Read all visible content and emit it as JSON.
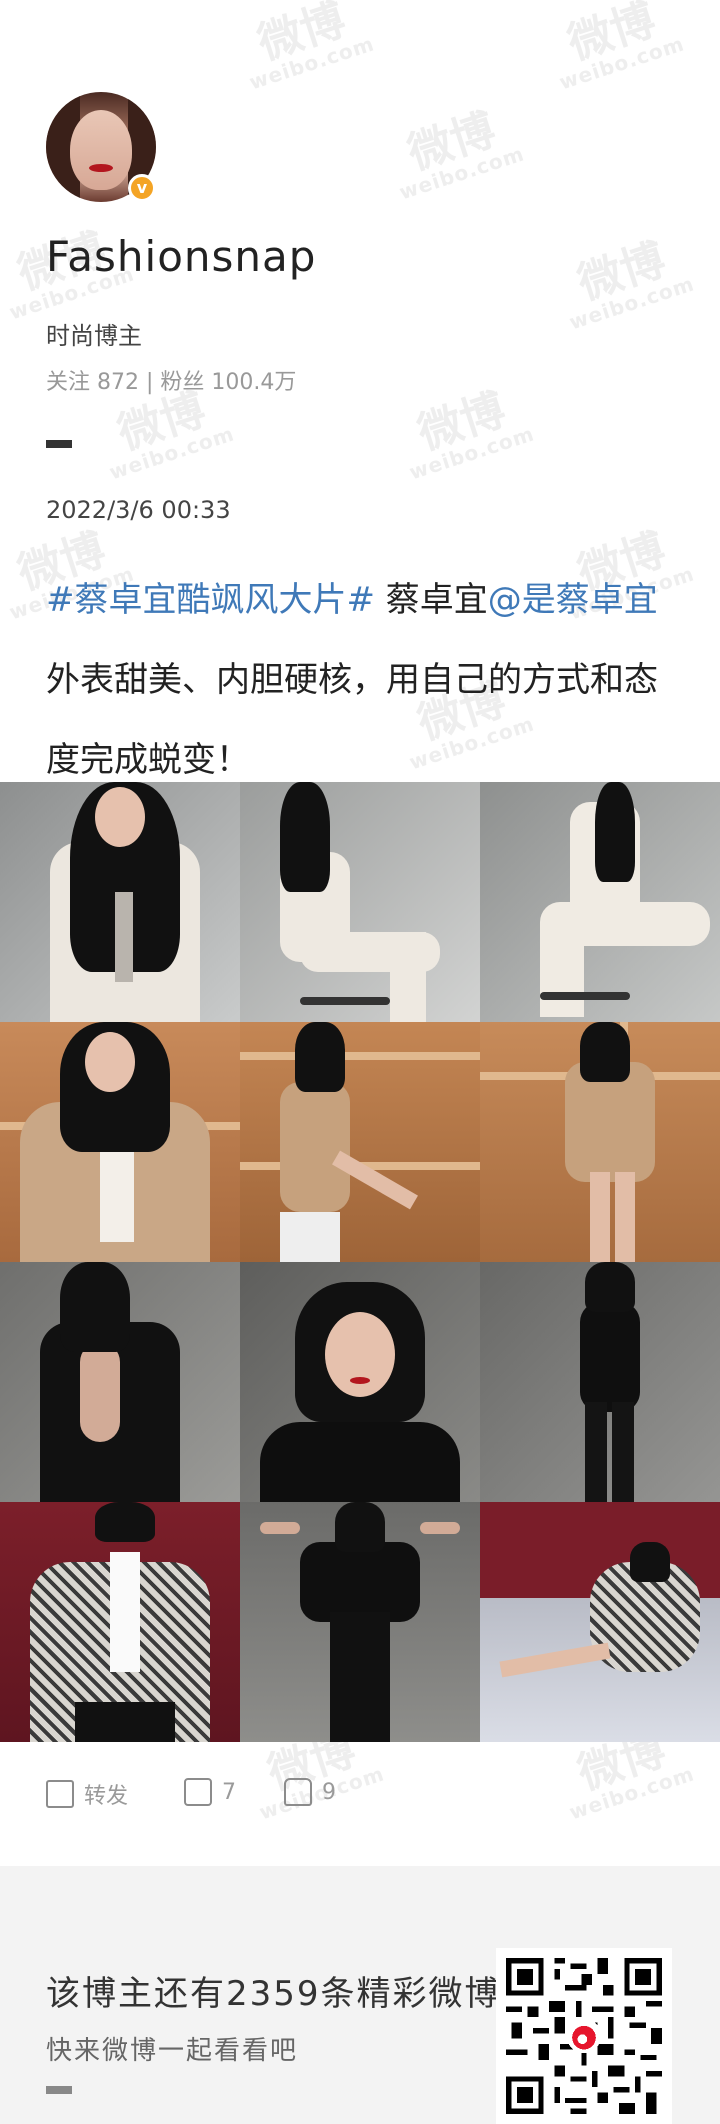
{
  "watermark": {
    "main": "微博",
    "sub": "weibo.com"
  },
  "profile": {
    "name": "Fashionsnap",
    "verified_mark": "v",
    "role": "时尚博主",
    "stats": "关注 872 | 粉丝 100.4万"
  },
  "post": {
    "date": "2022/3/6 00:33",
    "hashtag": "#蔡卓宜酷飒风大片#",
    "text_a": " 蔡卓宜",
    "mention": "@是蔡卓宜",
    "text_b": "外表甜美、内胆硬核，用自己的方式和态度完成蜕变！",
    "images_count": 9
  },
  "actions": {
    "repost": "转发",
    "comments": "7",
    "likes": "9"
  },
  "footer": {
    "title": "该博主还有2359条精彩微博",
    "subtitle": "快来微博一起看看吧"
  },
  "colors": {
    "link": "#3f79b8",
    "footer_bg": "#f3f3f3"
  }
}
